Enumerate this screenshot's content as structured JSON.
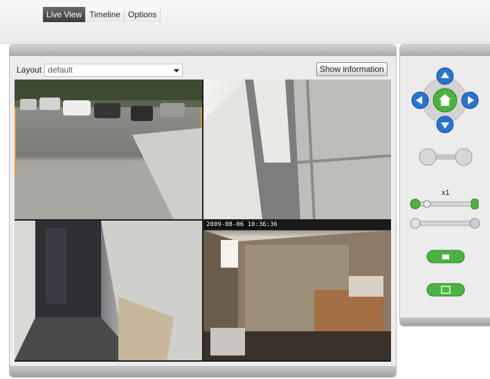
{
  "tabs": [
    {
      "label": "Live View",
      "active": true
    },
    {
      "label": "Timeline",
      "active": false
    },
    {
      "label": "Options",
      "active": false
    }
  ],
  "layout": {
    "label": "Layout",
    "selected": "default"
  },
  "show_info_label": "Show information",
  "cameras": [
    {
      "name": "parking-lot-camera",
      "timestamp": ""
    },
    {
      "name": "window-camera",
      "timestamp": ""
    },
    {
      "name": "hallway-camera",
      "timestamp": ""
    },
    {
      "name": "garage-camera",
      "timestamp": "2009-08-06 10:36:36"
    }
  ],
  "controls": {
    "zoom_label": "x1",
    "accent_color": "#4bb33f",
    "arrow_color": "#2a73d0"
  }
}
